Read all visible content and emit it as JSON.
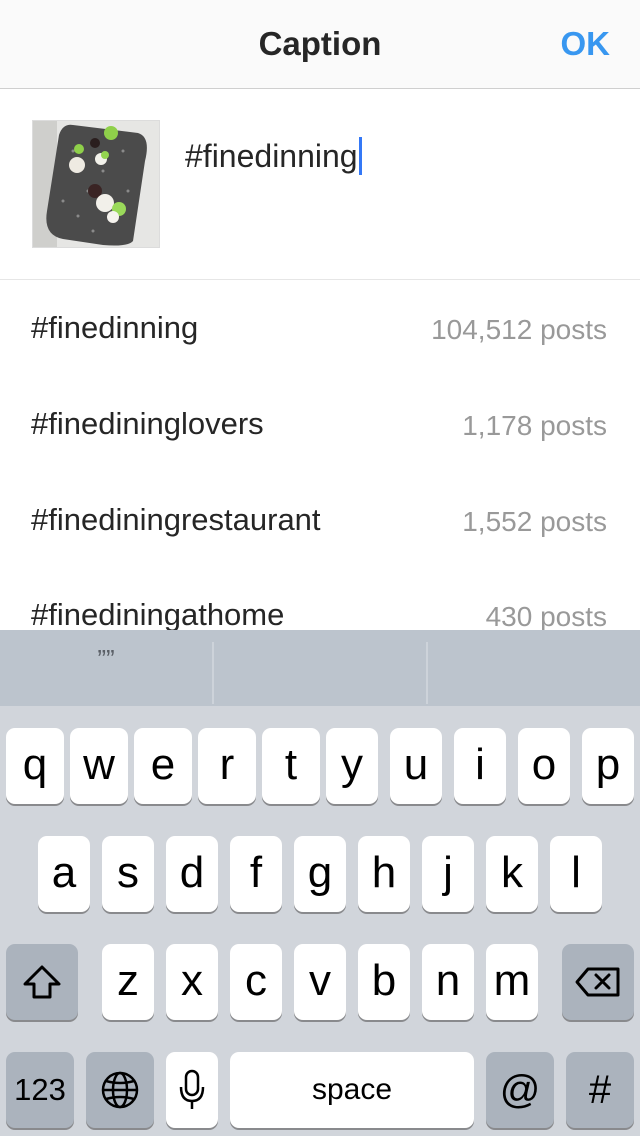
{
  "header": {
    "title": "Caption",
    "ok_label": "OK"
  },
  "compose": {
    "caption": "#finedinning"
  },
  "suggestions": [
    {
      "tag": "#finedinning",
      "count": "104,512 posts"
    },
    {
      "tag": "#finedininglovers",
      "count": "1,178 posts"
    },
    {
      "tag": "#finediningrestaurant",
      "count": "1,552 posts"
    },
    {
      "tag": "#finediningathome",
      "count": "430 posts"
    }
  ],
  "keyboard": {
    "predictions": [
      "””",
      "",
      ""
    ],
    "row1": [
      "q",
      "w",
      "e",
      "r",
      "t",
      "y",
      "u",
      "i",
      "o",
      "p"
    ],
    "row2": [
      "a",
      "s",
      "d",
      "f",
      "g",
      "h",
      "j",
      "k",
      "l"
    ],
    "row3": [
      "z",
      "x",
      "c",
      "v",
      "b",
      "n",
      "m"
    ],
    "num_label": "123",
    "space_label": "space",
    "at_label": "@",
    "hash_label": "#"
  },
  "icons": {
    "shift": "shift-icon",
    "backspace": "backspace-icon",
    "globe": "globe-icon",
    "mic": "microphone-icon"
  },
  "colors": {
    "accent": "#3897f0",
    "cursor": "#3478f6",
    "keyboard_bg": "#d1d5db"
  }
}
